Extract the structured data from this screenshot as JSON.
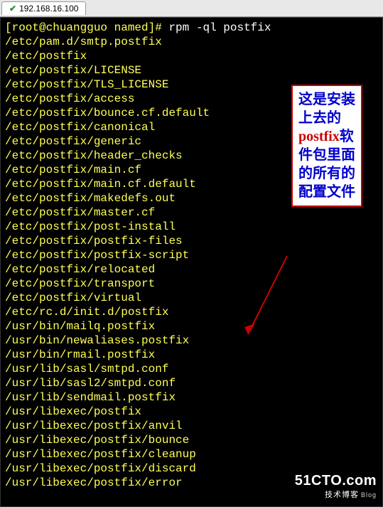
{
  "tab": {
    "label": "192.168.16.100"
  },
  "terminal": {
    "prompt_user": "[root@chuangguo named]#",
    "command": "rpm -ql postfix",
    "output": [
      "/etc/pam.d/smtp.postfix",
      "/etc/postfix",
      "/etc/postfix/LICENSE",
      "/etc/postfix/TLS_LICENSE",
      "/etc/postfix/access",
      "/etc/postfix/bounce.cf.default",
      "/etc/postfix/canonical",
      "/etc/postfix/generic",
      "/etc/postfix/header_checks",
      "/etc/postfix/main.cf",
      "/etc/postfix/main.cf.default",
      "/etc/postfix/makedefs.out",
      "/etc/postfix/master.cf",
      "/etc/postfix/post-install",
      "/etc/postfix/postfix-files",
      "/etc/postfix/postfix-script",
      "/etc/postfix/relocated",
      "/etc/postfix/transport",
      "/etc/postfix/virtual",
      "/etc/rc.d/init.d/postfix",
      "/usr/bin/mailq.postfix",
      "/usr/bin/newaliases.postfix",
      "/usr/bin/rmail.postfix",
      "/usr/lib/sasl/smtpd.conf",
      "/usr/lib/sasl2/smtpd.conf",
      "/usr/lib/sendmail.postfix",
      "/usr/libexec/postfix",
      "/usr/libexec/postfix/anvil",
      "/usr/libexec/postfix/bounce",
      "/usr/libexec/postfix/cleanup",
      "/usr/libexec/postfix/discard",
      "/usr/libexec/postfix/error"
    ]
  },
  "annotation": {
    "text_before": "这是安装上去的",
    "highlight": "postfix",
    "text_after": "软件包里面的所有的配置文件"
  },
  "watermark": {
    "brand": "51CTO.com",
    "sub": "技术博客",
    "blog": "Blog"
  }
}
